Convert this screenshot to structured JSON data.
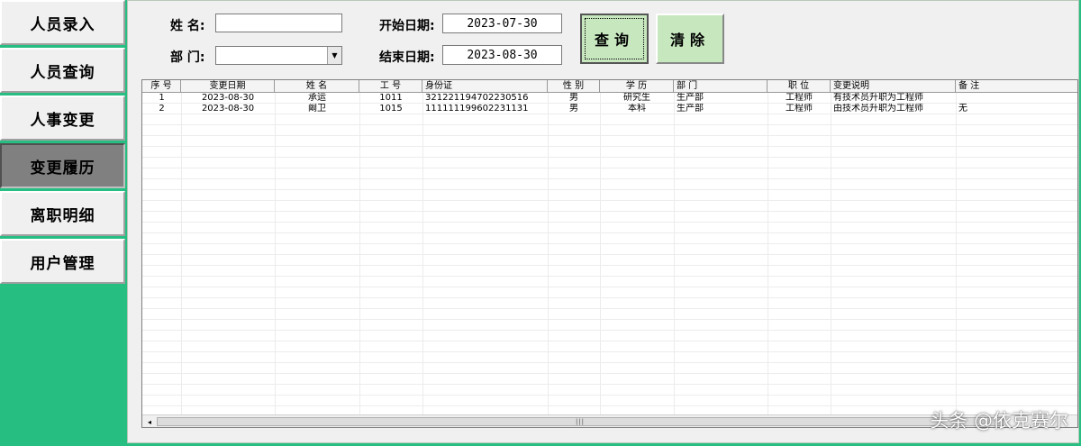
{
  "sidebar": {
    "items": [
      {
        "label": "人员录入",
        "active": false
      },
      {
        "label": "人员查询",
        "active": false
      },
      {
        "label": "人事变更",
        "active": false
      },
      {
        "label": "变更履历",
        "active": true
      },
      {
        "label": "离职明细",
        "active": false
      },
      {
        "label": "用户管理",
        "active": false
      }
    ]
  },
  "form": {
    "name_label": "姓 名:",
    "name_value": "",
    "dept_label": "部 门:",
    "dept_value": "",
    "start_label": "开始日期:",
    "start_value": "2023-07-30",
    "end_label": "结束日期:",
    "end_value": "2023-08-30"
  },
  "buttons": {
    "query": "查询",
    "clear": "清除"
  },
  "table": {
    "headers": [
      "序 号",
      "变更日期",
      "姓 名",
      "工 号",
      "身份证",
      "性 别",
      "学 历",
      "部 门",
      "职 位",
      "变更说明",
      "备 注"
    ],
    "rows": [
      [
        "1",
        "2023-08-30",
        "承运",
        "1011",
        "321221194702230516",
        "男",
        "研究生",
        "生产部",
        "工程师",
        "有技术员升职为工程师",
        ""
      ],
      [
        "2",
        "2023-08-30",
        "阚卫",
        "1015",
        "111111199602231131",
        "男",
        "本科",
        "生产部",
        "工程师",
        "由技术员升职为工程师",
        "无"
      ]
    ]
  },
  "scrollbar": {
    "left_arrow": "◂",
    "thumb_grip": "|||"
  },
  "watermark": "头条 @依克赛尔",
  "colors": {
    "sidebar_bg": "#27be82",
    "active_nav": "#808080",
    "button_green": "#c7e7be"
  }
}
